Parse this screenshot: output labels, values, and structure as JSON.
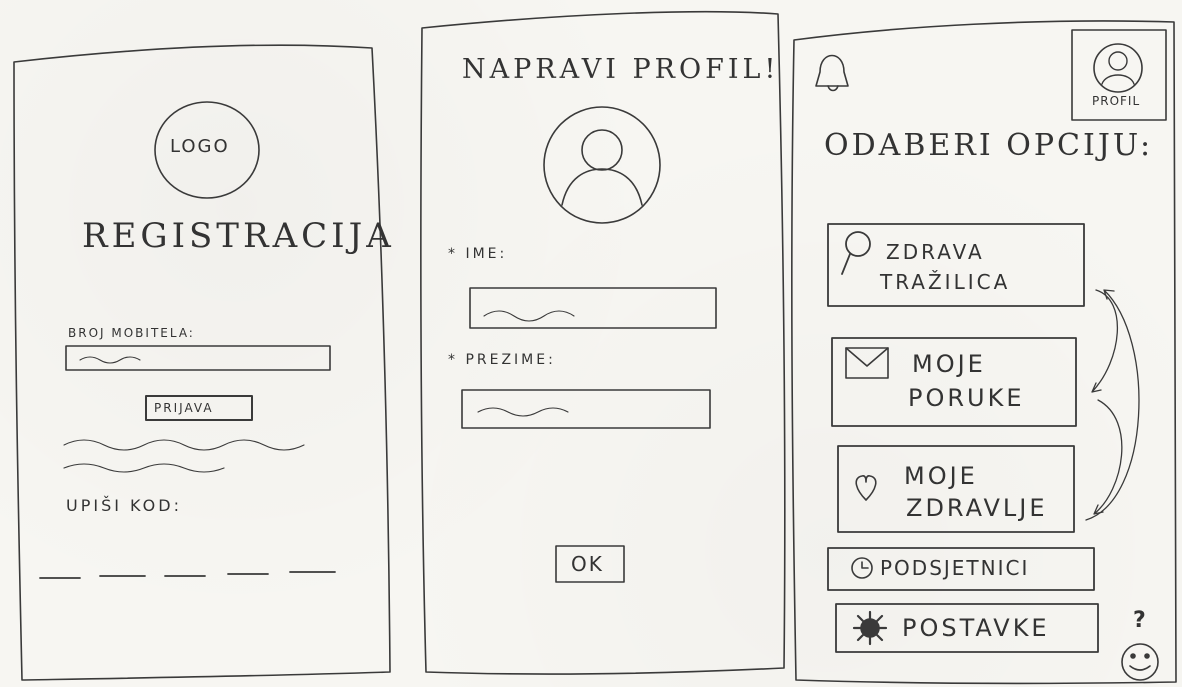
{
  "screen1": {
    "logo": "LOGO",
    "title": "REGISTRACIJA",
    "phone_label": "BROJ MOBITELA:",
    "submit_button": "PRIJAVA",
    "code_label": "UPIŠI KOD:"
  },
  "screen2": {
    "title": "NAPRAVI PROFIL!",
    "first_name_label": "* IME:",
    "last_name_label": "* PREZIME:",
    "ok_button": "OK"
  },
  "screen3": {
    "profile_label": "PROFIL",
    "heading": "ODABERI OPCIJU:",
    "menu": [
      {
        "line1": "ZDRAVA",
        "line2": "TRAŽILICA",
        "icon": "magnifier-icon"
      },
      {
        "line1": "MOJE",
        "line2": "PORUKE",
        "icon": "envelope-icon"
      },
      {
        "line1": "MOJE",
        "line2": "ZDRAVLJE",
        "icon": "heart-icon"
      },
      {
        "line1": "PODSJETNICI",
        "icon": "clock-icon"
      },
      {
        "line1": "POSTAVKE",
        "icon": "gear-icon"
      }
    ],
    "help_mark": "?"
  },
  "colors": {
    "paper": "#f7f6f2",
    "pencil": "#333333"
  }
}
